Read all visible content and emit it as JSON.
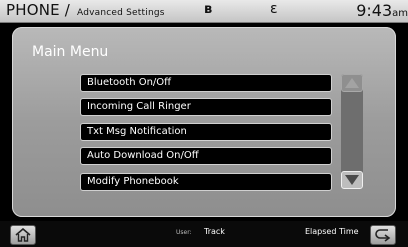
{
  "header": {
    "title": "PHONE /",
    "subtitle": "Advanced Settings",
    "bluetooth_icon": "bluetooth-icon",
    "phone_icon": "phone-signal-icon",
    "time": "9:43",
    "ampm": "am"
  },
  "main": {
    "title": "Main Menu",
    "items": [
      {
        "label": "Bluetooth On/Off"
      },
      {
        "label": "Incoming Call Ringer"
      },
      {
        "label": "Txt Msg Notification"
      },
      {
        "label": "Auto Download On/Off"
      },
      {
        "label": "Modify Phonebook"
      }
    ]
  },
  "scrollbar": {
    "up_icon": "triangle-up-icon",
    "down_icon": "triangle-down-icon"
  },
  "footer": {
    "home_icon": "home-icon",
    "user_label": "User:",
    "track_label": "Track",
    "elapsed_label": "Elapsed Time",
    "back_icon": "back-arrow-icon"
  }
}
